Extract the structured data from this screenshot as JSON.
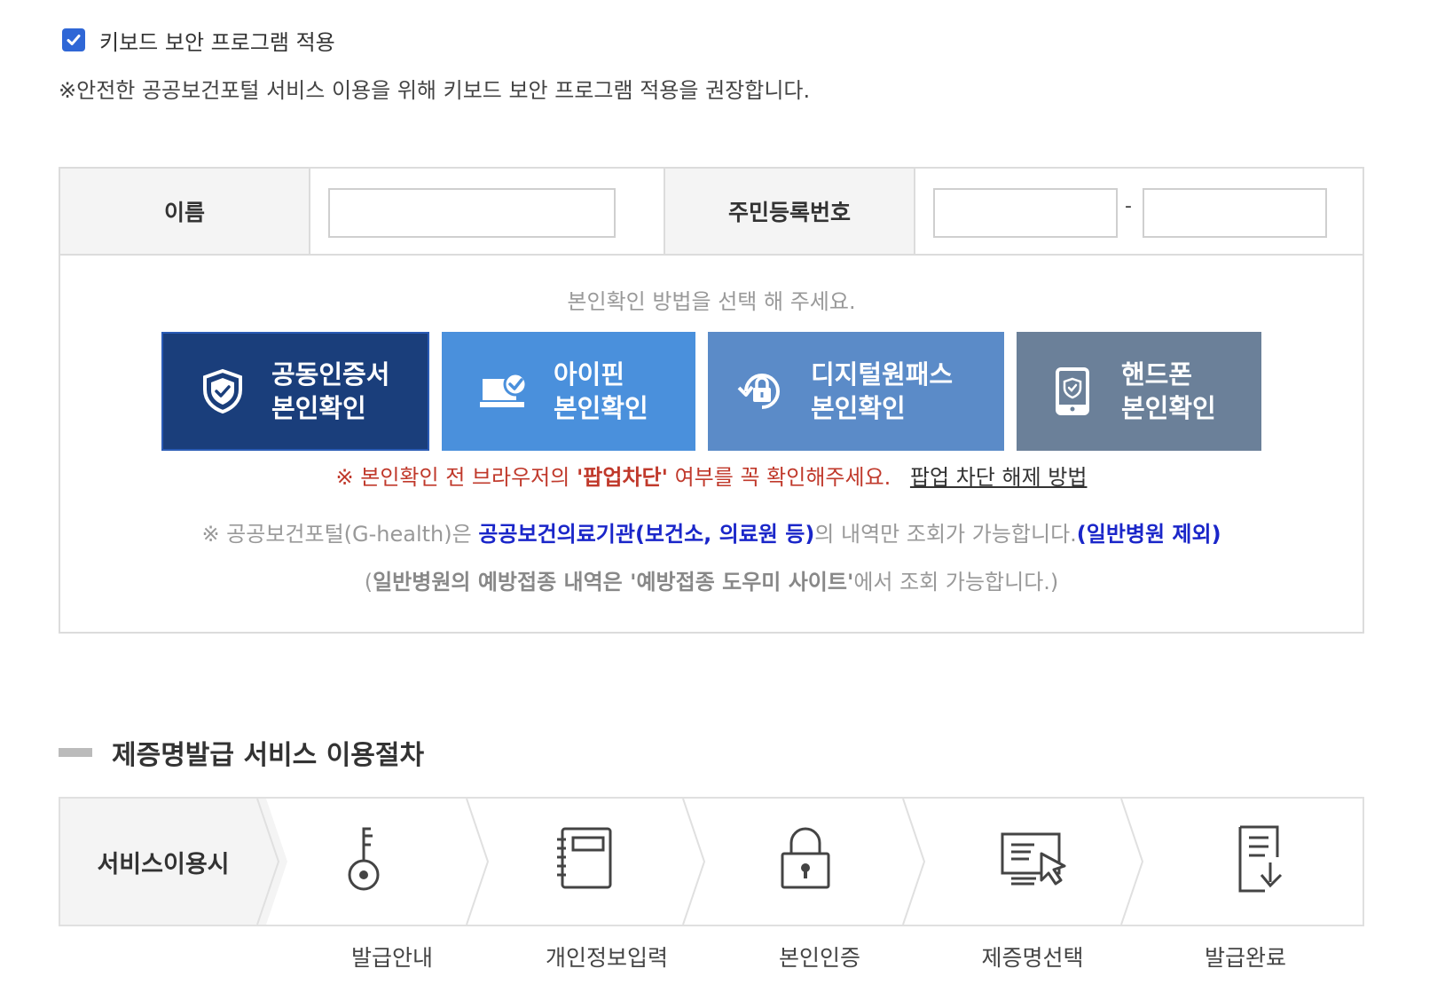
{
  "keyboard_security": {
    "label": "키보드 보안 프로그램 적용",
    "checked": true,
    "note": "※안전한 공공보건포털 서비스 이용을 위해 키보드 보안 프로그램 적용을 권장합니다."
  },
  "form": {
    "name_label": "이름",
    "name_value": "",
    "rrn_label": "주민등록번호",
    "rrn_front": "",
    "rrn_separator": "-",
    "rrn_back": ""
  },
  "verification": {
    "title": "본인확인 방법을 선택 해 주세요.",
    "methods": [
      {
        "line1": "공동인증서",
        "line2": "본인확인",
        "icon": "shield-check-icon",
        "color": "#1a3e7b"
      },
      {
        "line1": "아이핀",
        "line2": "본인확인",
        "icon": "laptop-check-icon",
        "color": "#4a90dc"
      },
      {
        "line1": "디지털원패스",
        "line2": "본인확인",
        "icon": "refresh-lock-icon",
        "color": "#5b8bc8"
      },
      {
        "line1": "핸드폰",
        "line2": "본인확인",
        "icon": "phone-shield-icon",
        "color": "#6b8099"
      }
    ],
    "popup_notice_prefix": "※ 본인확인 전 브라우저의 ",
    "popup_notice_strong": "'팝업차단'",
    "popup_notice_suffix": " 여부를 꼭 확인해주세요.",
    "popup_link": "팝업 차단 해제 방법",
    "info1_prefix": "※ 공공보건포털(G-health)은 ",
    "info1_blue": "공공보건의료기관(보건소, 의료원 등)",
    "info1_mid": "의 내역만 조회가 가능합니다.",
    "info1_blue2": "(일반병원 제외)",
    "info2_prefix": "(",
    "info2_bold": "일반병원의 예방접종 내역은 '예방접종 도우미 사이트'",
    "info2_suffix": "에서 조회 가능합니다.)"
  },
  "procedure": {
    "title": "제증명발급 서비스 이용절차",
    "start_label": "서비스이용시",
    "steps": [
      {
        "label": "발급안내",
        "icon": "key-icon"
      },
      {
        "label": "개인정보입력",
        "icon": "notebook-icon"
      },
      {
        "label": "본인인증",
        "icon": "padlock-icon"
      },
      {
        "label": "제증명선택",
        "icon": "document-cursor-icon"
      },
      {
        "label": "발급완료",
        "icon": "document-download-icon"
      }
    ]
  }
}
